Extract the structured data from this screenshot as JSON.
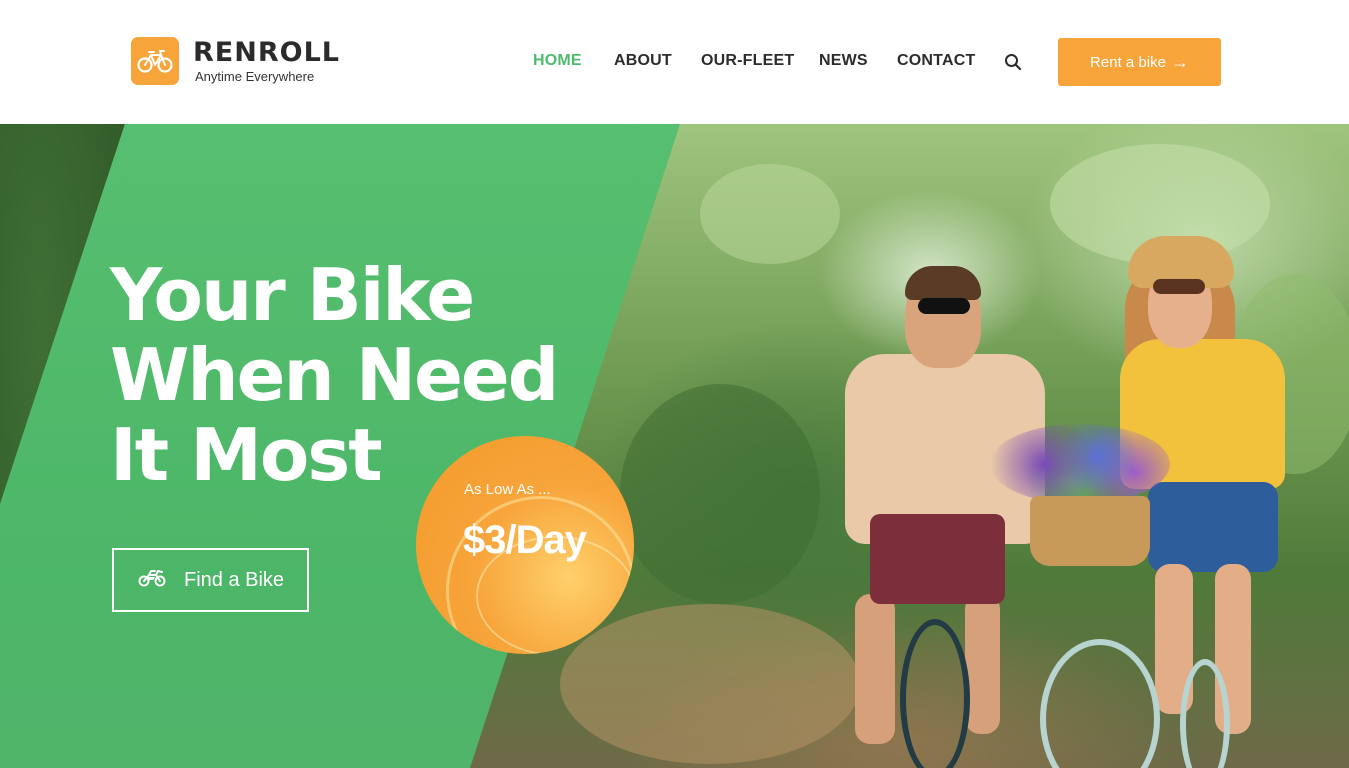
{
  "brand": {
    "name": "RENROLL",
    "tagline": "Anytime Everywhere",
    "logo_icon": "bicycle-icon",
    "accent_color": "#f7a43a"
  },
  "nav": {
    "items": [
      {
        "label": "HOME",
        "active": true
      },
      {
        "label": "ABOUT",
        "active": false
      },
      {
        "label": "OUR-FLEET",
        "active": false
      },
      {
        "label": "NEWS",
        "active": false
      },
      {
        "label": "CONTACT",
        "active": false
      }
    ],
    "active_color": "#4fbb6f",
    "search_icon": "search-icon"
  },
  "header": {
    "cta_label": "Rent a bike",
    "cta_icon": "arrow-right-icon"
  },
  "hero": {
    "headline_lines": [
      "Your Bike",
      "When Need",
      "It Most"
    ],
    "button_label": "Find a Bike",
    "button_icon": "motorbike-icon",
    "panel_color": "#4cbe6e",
    "price": {
      "label": "As Low As ...",
      "value": "$3/Day"
    }
  }
}
